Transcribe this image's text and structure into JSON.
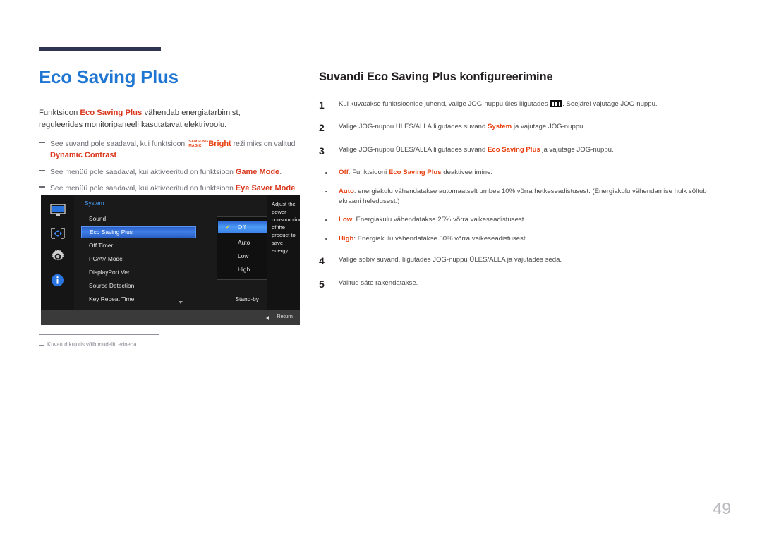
{
  "colors": {
    "title_blue": "#1f76d2",
    "accent_red": "#e8400f",
    "rule_navy": "#2e3552",
    "osd_background": "#131313",
    "osd_highlight_blue": "#3f7ee8",
    "osd_title_blue": "#4a9cf0",
    "check_yellow": "#f3e03a",
    "page_number_gray": "#b9b9bd"
  },
  "left": {
    "title": "Eco Saving Plus",
    "intro_pre": "Funktsioon ",
    "intro_bold": "Eco Saving Plus",
    "intro_post": " vähendab energiatarbimist, reguleerides monitoripaneeli kasutatavat elektrivoolu.",
    "notes": [
      {
        "pre": "See suvand pole saadaval, kui funktsiooni ",
        "logo_line1": "SAMSUNG",
        "logo_line2": "MAGIC",
        "logo_word": "Bright",
        "mid": " režiimiks on valitud ",
        "emph": "Dynamic Contrast",
        "post": "."
      },
      {
        "pre": "See menüü pole saadaval, kui aktiveeritud on funktsioon ",
        "emph": "Game Mode",
        "post": "."
      },
      {
        "pre": "See menüü pole saadaval, kui aktiveeritud on funktsioon ",
        "emph": "Eye Saver Mode",
        "post": "."
      }
    ],
    "footnote": "Kuvatud kujutis võib mudeliti erineda."
  },
  "osd": {
    "menu_title": "System",
    "icons": [
      "monitor-icon",
      "picture-adjust-icon",
      "gear-icon",
      "info-icon"
    ],
    "rows": [
      {
        "label": "Sound",
        "value": "",
        "selected": false
      },
      {
        "label": "Eco Saving Plus",
        "value": "",
        "selected": true
      },
      {
        "label": "Off Timer",
        "value": "",
        "selected": false
      },
      {
        "label": "PC/AV Mode",
        "value": "",
        "selected": false
      },
      {
        "label": "DisplayPort Ver.",
        "value": "",
        "selected": false
      },
      {
        "label": "Source Detection",
        "value": "",
        "selected": false
      },
      {
        "label": "Key Repeat Time",
        "value": "Stand-by",
        "selected": false
      }
    ],
    "submenu": [
      {
        "label": "Off",
        "checked": true,
        "selected": true
      },
      {
        "label": "Auto",
        "checked": false,
        "selected": false
      },
      {
        "label": "Low",
        "checked": false,
        "selected": false
      },
      {
        "label": "High",
        "checked": false,
        "selected": false
      }
    ],
    "description": "Adjust the power consumption of the product to save energy.",
    "footer_return": "Return"
  },
  "right": {
    "title": "Suvandi Eco Saving Plus konfigureerimine",
    "steps": [
      {
        "num": "1",
        "segments": [
          {
            "t": "Kui kuvatakse funktsioonide juhend, valige JOG-nuppu üles liigutades ",
            "s": "plain"
          },
          {
            "t": "",
            "s": "menu-glyph"
          },
          {
            "t": ". Seejärel vajutage JOG-nuppu.",
            "s": "plain"
          }
        ]
      },
      {
        "num": "2",
        "segments": [
          {
            "t": "Valige JOG-nuppu ÜLES/ALLA liigutades suvand ",
            "s": "plain"
          },
          {
            "t": "System",
            "s": "red"
          },
          {
            "t": " ja vajutage JOG-nuppu.",
            "s": "plain"
          }
        ]
      },
      {
        "num": "3",
        "segments": [
          {
            "t": "Valige JOG-nuppu ÜLES/ALLA liigutades suvand ",
            "s": "plain"
          },
          {
            "t": "Eco Saving Plus",
            "s": "red"
          },
          {
            "t": " ja vajutage JOG-nuppu.",
            "s": "plain"
          }
        ]
      }
    ],
    "bullets": [
      {
        "segments": [
          {
            "t": "Off",
            "s": "red"
          },
          {
            "t": ": Funktsiooni ",
            "s": "plain"
          },
          {
            "t": "Eco Saving Plus",
            "s": "red"
          },
          {
            "t": " deaktiveerimine.",
            "s": "plain"
          }
        ]
      },
      {
        "segments": [
          {
            "t": "Auto",
            "s": "red"
          },
          {
            "t": ": energiakulu vähendatakse automaatselt umbes 10% võrra hetkeseadistusest. (Energiakulu vähendamise hulk sõltub ekraani heledusest.)",
            "s": "plain"
          }
        ]
      },
      {
        "segments": [
          {
            "t": "Low",
            "s": "red"
          },
          {
            "t": ": Energiakulu vähendatakse 25% võrra vaikeseadistusest.",
            "s": "plain"
          }
        ]
      },
      {
        "segments": [
          {
            "t": "High",
            "s": "red"
          },
          {
            "t": ": Energiakulu vähendatakse 50% võrra vaikeseadistusest.",
            "s": "plain"
          }
        ]
      }
    ],
    "steps_after": [
      {
        "num": "4",
        "segments": [
          {
            "t": "Valige sobiv suvand, liigutades JOG-nuppu ÜLES/ALLA ja vajutades seda.",
            "s": "plain"
          }
        ]
      },
      {
        "num": "5",
        "segments": [
          {
            "t": "Valitud säte rakendatakse.",
            "s": "plain"
          }
        ]
      }
    ]
  },
  "page_number": "49"
}
